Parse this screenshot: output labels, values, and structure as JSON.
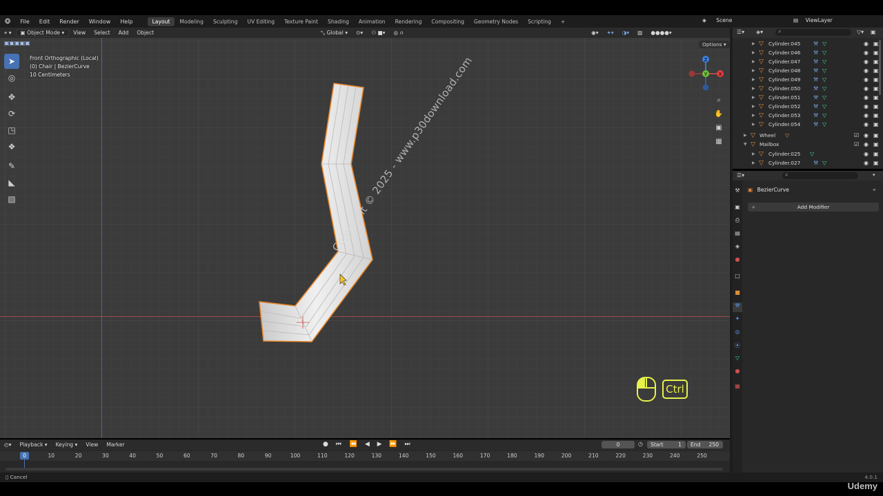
{
  "menubar": {
    "items": [
      "File",
      "Edit",
      "Render",
      "Window",
      "Help"
    ],
    "workspaces": [
      "Layout",
      "Modeling",
      "Sculpting",
      "UV Editing",
      "Texture Paint",
      "Shading",
      "Animation",
      "Rendering",
      "Compositing",
      "Geometry Nodes",
      "Scripting"
    ],
    "active_workspace": "Layout",
    "add_tab": "+",
    "scene": "Scene",
    "view_layer": "ViewLayer"
  },
  "viewport_header": {
    "mode": "Object Mode",
    "menus": [
      "View",
      "Select",
      "Add",
      "Object"
    ],
    "transform_orientation": "Global",
    "options": "Options"
  },
  "viewport_info": {
    "line1": "Front Orthographic (Local)",
    "line2": "(0) Chair | BezierCurve",
    "line3": "10 Centimeters"
  },
  "gizmo": {
    "z": "Z",
    "y": "Y",
    "x": "X"
  },
  "watermark": "Copyright © 2025 - www.p30download.com",
  "key_overlay": {
    "key": "Ctrl"
  },
  "outliner": {
    "rows": [
      {
        "name": "Cylinder.045",
        "type": "child"
      },
      {
        "name": "Cylinder.046",
        "type": "child"
      },
      {
        "name": "Cylinder.047",
        "type": "child"
      },
      {
        "name": "Cylinder.048",
        "type": "child"
      },
      {
        "name": "Cylinder.049",
        "type": "child"
      },
      {
        "name": "Cylinder.050",
        "type": "child"
      },
      {
        "name": "Cylinder.051",
        "type": "child"
      },
      {
        "name": "Cylinder.052",
        "type": "child"
      },
      {
        "name": "Cylinder.053",
        "type": "child"
      },
      {
        "name": "Cylinder.054",
        "type": "child"
      },
      {
        "name": "Wheel",
        "type": "parent"
      },
      {
        "name": "Mailbox",
        "type": "parent"
      },
      {
        "name": "Cylinder.025",
        "type": "child"
      },
      {
        "name": "Cylinder.027",
        "type": "child"
      }
    ]
  },
  "properties": {
    "object_name": "BezierCurve",
    "add_modifier": "Add Modifier"
  },
  "timeline": {
    "menus": [
      "Playback",
      "Keying",
      "View",
      "Marker"
    ],
    "current_frame": "0",
    "start_label": "Start",
    "start_value": "1",
    "end_label": "End",
    "end_value": "250",
    "ruler_ticks": [
      "0",
      "10",
      "20",
      "30",
      "40",
      "50",
      "60",
      "70",
      "80",
      "90",
      "100",
      "110",
      "120",
      "130",
      "140",
      "150",
      "160",
      "170",
      "180",
      "190",
      "200",
      "210",
      "220",
      "230",
      "240",
      "250"
    ]
  },
  "status": {
    "cancel": "Cancel",
    "version": "4.0.1"
  },
  "branding": "Udemy",
  "colors": {
    "selection_outline": "#e8862a",
    "active_tool": "#4772b3",
    "key_overlay": "#e7f24b",
    "mesh_icon": "#3cd9a5",
    "object_icon": "#e08d3b"
  }
}
